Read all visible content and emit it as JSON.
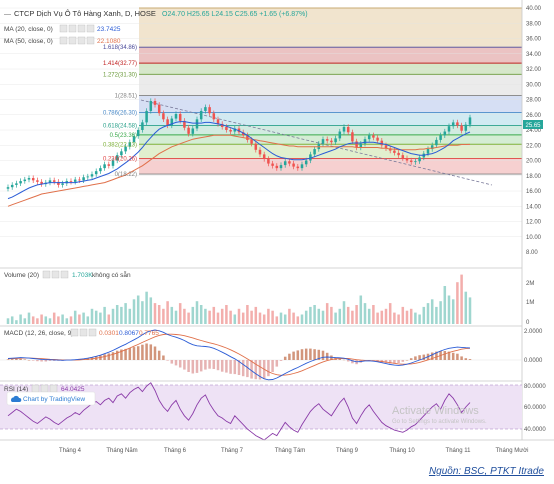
{
  "header": {
    "title": "CTCP Dịch Vụ Ô Tô Hàng Xanh, D, HOSE",
    "ohlc": "O24.70  H25.65  L24.15  C25.65  +1.65 (+6.87%)",
    "ma20_label": "MA (20, close, 0)",
    "ma20_value": "23.7425",
    "ma50_label": "MA (50, close, 0)",
    "ma50_value": "22.1080",
    "last_price_tag": "25.65"
  },
  "volume_panel": {
    "label": "Volume (20)",
    "value": "1.703K",
    "extra": "không có sẵn",
    "ticks": [
      "2M",
      "1M",
      "0"
    ]
  },
  "macd_panel": {
    "label": "MACD (12, 26, close, 9)",
    "v1": "0.0301",
    "v2": "0.8067",
    "v3": "0.7765",
    "ticks": [
      "2.0000",
      "0.0000"
    ]
  },
  "rsi_panel": {
    "label": "RSI (14)",
    "value": "64.0425",
    "ticks": [
      "80.0000",
      "60.0000",
      "40.0000"
    ]
  },
  "badge": {
    "text": "Chart by TradingView"
  },
  "watermark": {
    "line1": "Activate Windows",
    "line2": "Go to Settings to activate Windows."
  },
  "source": "Nguồn: BSC, PTKT Itrade",
  "colors": {
    "up": "#26a69a",
    "down": "#ef5350",
    "ma20": "#2b5cd6",
    "ma50": "#e0704a",
    "macd": "#2b5cd6",
    "signal": "#e0704a",
    "rsi": "#8a3ba8"
  },
  "chart_data": {
    "type": "candlestick",
    "x_ticks": [
      "Tháng 4",
      "Tháng Năm",
      "Tháng 6",
      "Tháng 7",
      "Tháng Tám",
      "Tháng 9",
      "Tháng 10",
      "Tháng 11",
      "Tháng Mười"
    ],
    "y_ticks": [
      "40.00",
      "38.00",
      "36.00",
      "34.00",
      "32.00",
      "30.00",
      "28.00",
      "26.00",
      "24.00",
      "22.00",
      "20.00",
      "18.00",
      "16.00",
      "14.00",
      "12.00",
      "10.00",
      "8.00"
    ],
    "ylim": [
      8,
      40
    ],
    "fib_levels": [
      {
        "label": "0(18.22)",
        "value": 18.22,
        "color": "#808080"
      },
      {
        "label": "0.236(20.26)",
        "value": 20.26,
        "color": "#e04040"
      },
      {
        "label": "0.382(22.13)",
        "value": 22.13,
        "color": "#7fb23a"
      },
      {
        "label": "0.5(23.36)",
        "value": 23.36,
        "color": "#3aa84a"
      },
      {
        "label": "0.618(24.58)",
        "value": 24.58,
        "color": "#2aa08a"
      },
      {
        "label": "0.786(26.30)",
        "value": 26.3,
        "color": "#4a8ac8"
      },
      {
        "label": "1(28.51)",
        "value": 28.51,
        "color": "#808080"
      },
      {
        "label": "1.272(31.30)",
        "value": 31.3,
        "color": "#6a9a3a"
      },
      {
        "label": "1.414(32.77)",
        "value": 32.77,
        "color": "#c02020"
      },
      {
        "label": "1.618(34.86)",
        "value": 34.86,
        "color": "#4a4a9a"
      },
      {
        "label": "",
        "value": 40.0,
        "color": "#b8862a"
      }
    ],
    "series": [
      {
        "name": "price",
        "values": [
          16.5,
          16.8,
          17.0,
          17.3,
          17.5,
          17.7,
          17.4,
          17.2,
          16.9,
          17.1,
          17.4,
          17.2,
          16.8,
          17.0,
          17.3,
          17.2,
          17.5,
          17.4,
          17.8,
          17.9,
          18.2,
          18.6,
          19.0,
          19.5,
          19.3,
          20.0,
          20.7,
          21.2,
          21.8,
          22.4,
          23.2,
          24.0,
          25.0,
          26.5,
          27.8,
          27.3,
          26.2,
          25.4,
          24.6,
          25.5,
          26.1,
          25.2,
          24.3,
          23.5,
          24.2,
          25.4,
          26.5,
          27.0,
          26.2,
          25.4,
          24.8,
          24.4,
          24.0,
          23.8,
          24.2,
          23.7,
          23.3,
          22.7,
          22.2,
          21.4,
          20.8,
          20.2,
          19.6,
          19.3,
          19.0,
          19.4,
          19.9,
          19.6,
          19.2,
          19.0,
          19.5,
          20.0,
          20.8,
          21.5,
          22.2,
          22.8,
          22.6,
          22.4,
          22.9,
          23.8,
          24.4,
          23.7,
          22.5,
          21.7,
          22.2,
          22.8,
          23.3,
          23.0,
          22.6,
          22.0,
          21.6,
          21.3,
          21.0,
          20.7,
          20.3,
          20.0,
          19.8,
          19.9,
          20.4,
          20.9,
          21.5,
          22.0,
          22.7,
          23.3,
          23.8,
          24.5,
          25.0,
          24.6,
          23.9,
          24.7,
          25.65
        ]
      },
      {
        "name": "MA (20)",
        "values": [
          15.0,
          15.2,
          15.5,
          15.8,
          16.1,
          16.4,
          16.6,
          16.8,
          16.9,
          17.0,
          17.1,
          17.1,
          17.1,
          17.1,
          17.1,
          17.1,
          17.1,
          17.2,
          17.3,
          17.4,
          17.5,
          17.7,
          17.9,
          18.1,
          18.3,
          18.6,
          18.9,
          19.3,
          19.7,
          20.1,
          20.6,
          21.1,
          21.7,
          22.4,
          23.0,
          23.6,
          24.1,
          24.4,
          24.6,
          24.8,
          25.0,
          25.1,
          25.1,
          25.0,
          24.9,
          24.9,
          24.9,
          25.0,
          25.0,
          24.9,
          24.8,
          24.7,
          24.5,
          24.3,
          24.1,
          23.9,
          23.6,
          23.3,
          22.9,
          22.5,
          22.1,
          21.7,
          21.3,
          20.9,
          20.6,
          20.4,
          20.3,
          20.2,
          20.1,
          20.1,
          20.1,
          20.2,
          20.3,
          20.5,
          20.7,
          20.9,
          21.1,
          21.3,
          21.5,
          21.8,
          22.0,
          22.2,
          22.3,
          22.3,
          22.3,
          22.4,
          22.4,
          22.4,
          22.3,
          22.2,
          22.1,
          21.9,
          21.7,
          21.5,
          21.3,
          21.1,
          20.9,
          20.8,
          20.7,
          20.7,
          20.8,
          20.9,
          21.1,
          21.4,
          21.7,
          22.1,
          22.6,
          22.9,
          23.2,
          23.5,
          23.74
        ]
      },
      {
        "name": "MA (50)",
        "values": [
          14.0,
          14.2,
          14.4,
          14.6,
          14.8,
          15.0,
          15.2,
          15.4,
          15.6,
          15.7,
          15.8,
          15.9,
          16.0,
          16.1,
          16.2,
          16.3,
          16.4,
          16.5,
          16.6,
          16.7,
          16.8,
          16.9,
          17.0,
          17.1,
          17.3,
          17.5,
          17.7,
          17.9,
          18.1,
          18.4,
          18.7,
          19.0,
          19.3,
          19.7,
          20.1,
          20.5,
          20.9,
          21.2,
          21.5,
          21.8,
          22.0,
          22.2,
          22.4,
          22.6,
          22.8,
          22.9,
          23.0,
          23.1,
          23.2,
          23.3,
          23.3,
          23.3,
          23.3,
          23.3,
          23.2,
          23.1,
          23.0,
          22.9,
          22.8,
          22.7,
          22.6,
          22.5,
          22.4,
          22.3,
          22.2,
          22.1,
          22.0,
          21.9,
          21.9,
          21.8,
          21.8,
          21.8,
          21.8,
          21.8,
          21.8,
          21.8,
          21.8,
          21.8,
          21.8,
          21.8,
          21.8,
          21.8,
          21.8,
          21.7,
          21.7,
          21.7,
          21.7,
          21.7,
          21.7,
          21.6,
          21.6,
          21.5,
          21.5,
          21.4,
          21.4,
          21.4,
          21.4,
          21.4,
          21.5,
          21.5,
          21.6,
          21.6,
          21.7,
          21.8,
          21.9,
          22.0,
          22.0,
          22.0,
          22.1,
          22.1,
          22.11
        ]
      },
      {
        "name": "Volume (20)",
        "values": [
          0.3,
          0.4,
          0.2,
          0.5,
          0.3,
          0.6,
          0.4,
          0.3,
          0.5,
          0.4,
          0.3,
          0.6,
          0.4,
          0.5,
          0.3,
          0.4,
          0.7,
          0.5,
          0.6,
          0.4,
          0.8,
          0.7,
          0.6,
          0.9,
          0.5,
          0.8,
          1.0,
          0.9,
          1.1,
          0.8,
          1.3,
          1.5,
          1.2,
          1.7,
          1.4,
          1.1,
          1.0,
          0.8,
          1.2,
          0.9,
          0.7,
          1.1,
          0.8,
          0.6,
          0.9,
          1.2,
          1.0,
          0.8,
          0.7,
          0.9,
          0.6,
          0.8,
          1.0,
          0.7,
          0.5,
          0.8,
          0.6,
          1.0,
          0.7,
          0.9,
          0.6,
          0.5,
          0.8,
          0.7,
          0.4,
          0.6,
          0.5,
          0.8,
          0.6,
          0.4,
          0.5,
          0.7,
          0.9,
          1.0,
          0.8,
          0.7,
          1.1,
          0.9,
          0.6,
          0.8,
          1.2,
          0.9,
          0.7,
          1.0,
          1.5,
          1.1,
          0.8,
          1.0,
          0.6,
          0.7,
          0.8,
          1.1,
          0.6,
          0.5,
          0.9,
          0.7,
          0.8,
          0.6,
          0.5,
          0.9,
          1.1,
          1.3,
          0.9,
          1.2,
          2.0,
          1.5,
          1.3,
          2.2,
          2.6,
          1.7,
          1.4,
          1.9,
          1.1
        ]
      },
      {
        "name": "MACD",
        "values": [
          0.1,
          0.12,
          0.14,
          0.16,
          0.15,
          0.13,
          0.1,
          0.07,
          0.04,
          0.02,
          0.02,
          0.01,
          -0.01,
          -0.02,
          -0.01,
          0.0,
          0.02,
          0.05,
          0.08,
          0.12,
          0.18,
          0.25,
          0.32,
          0.42,
          0.52,
          0.64,
          0.78,
          0.92,
          1.05,
          1.2,
          1.35,
          1.5,
          1.68,
          1.85,
          1.95,
          2.0,
          1.95,
          1.85,
          1.7,
          1.6,
          1.52,
          1.42,
          1.3,
          1.15,
          1.02,
          0.95,
          0.92,
          0.9,
          0.86,
          0.78,
          0.66,
          0.52,
          0.38,
          0.22,
          0.08,
          -0.1,
          -0.3,
          -0.5,
          -0.72,
          -0.92,
          -1.1,
          -1.25,
          -1.32,
          -1.3,
          -1.2,
          -1.05,
          -0.9,
          -0.76,
          -0.62,
          -0.5,
          -0.36,
          -0.22,
          -0.1,
          0.0,
          0.1,
          0.18,
          0.2,
          0.18,
          0.16,
          0.15,
          0.12,
          0.05,
          -0.05,
          -0.12,
          -0.1,
          -0.06,
          -0.05,
          -0.08,
          -0.12,
          -0.18,
          -0.24,
          -0.3,
          -0.34,
          -0.36,
          -0.34,
          -0.28,
          -0.2,
          -0.1,
          0.0,
          0.1,
          0.22,
          0.35,
          0.48,
          0.6,
          0.7,
          0.78,
          0.82,
          0.86,
          0.84,
          0.82,
          0.81
        ]
      },
      {
        "name": "Signal",
        "values": [
          0.08,
          0.09,
          0.1,
          0.12,
          0.13,
          0.13,
          0.12,
          0.11,
          0.09,
          0.07,
          0.05,
          0.04,
          0.02,
          0.01,
          0.0,
          0.0,
          0.0,
          0.01,
          0.03,
          0.05,
          0.08,
          0.12,
          0.17,
          0.23,
          0.3,
          0.38,
          0.47,
          0.57,
          0.68,
          0.8,
          0.92,
          1.04,
          1.17,
          1.3,
          1.43,
          1.55,
          1.64,
          1.7,
          1.72,
          1.72,
          1.7,
          1.67,
          1.62,
          1.55,
          1.47,
          1.38,
          1.3,
          1.22,
          1.15,
          1.08,
          1.0,
          0.91,
          0.8,
          0.68,
          0.55,
          0.4,
          0.24,
          0.07,
          -0.1,
          -0.28,
          -0.45,
          -0.62,
          -0.78,
          -0.9,
          -0.98,
          -1.02,
          -1.01,
          -0.97,
          -0.9,
          -0.82,
          -0.72,
          -0.6,
          -0.48,
          -0.36,
          -0.24,
          -0.13,
          -0.04,
          0.03,
          0.08,
          0.1,
          0.11,
          0.1,
          0.06,
          0.02,
          -0.01,
          -0.03,
          -0.04,
          -0.05,
          -0.07,
          -0.1,
          -0.14,
          -0.18,
          -0.22,
          -0.26,
          -0.28,
          -0.28,
          -0.26,
          -0.22,
          -0.16,
          -0.08,
          0.01,
          0.1,
          0.2,
          0.3,
          0.4,
          0.5,
          0.58,
          0.65,
          0.72,
          0.76,
          0.78
        ]
      },
      {
        "name": "RSI",
        "values": [
          52,
          55,
          58,
          56,
          53,
          50,
          47,
          45,
          48,
          51,
          49,
          46,
          44,
          47,
          50,
          52,
          55,
          53,
          57,
          60,
          63,
          65,
          62,
          66,
          68,
          64,
          70,
          72,
          68,
          73,
          76,
          78,
          74,
          79,
          82,
          75,
          66,
          60,
          56,
          62,
          66,
          58,
          52,
          48,
          54,
          62,
          68,
          71,
          63,
          57,
          52,
          50,
          47,
          45,
          52,
          48,
          44,
          40,
          37,
          34,
          32,
          30,
          33,
          36,
          34,
          40,
          46,
          42,
          39,
          37,
          44,
          50,
          56,
          60,
          63,
          58,
          55,
          52,
          58,
          64,
          68,
          60,
          50,
          45,
          52,
          58,
          62,
          56,
          51,
          46,
          43,
          41,
          39,
          38,
          37,
          39,
          42,
          44,
          48,
          52,
          56,
          60,
          63,
          58,
          66,
          72,
          68,
          62,
          55,
          60,
          64.04
        ]
      }
    ]
  }
}
